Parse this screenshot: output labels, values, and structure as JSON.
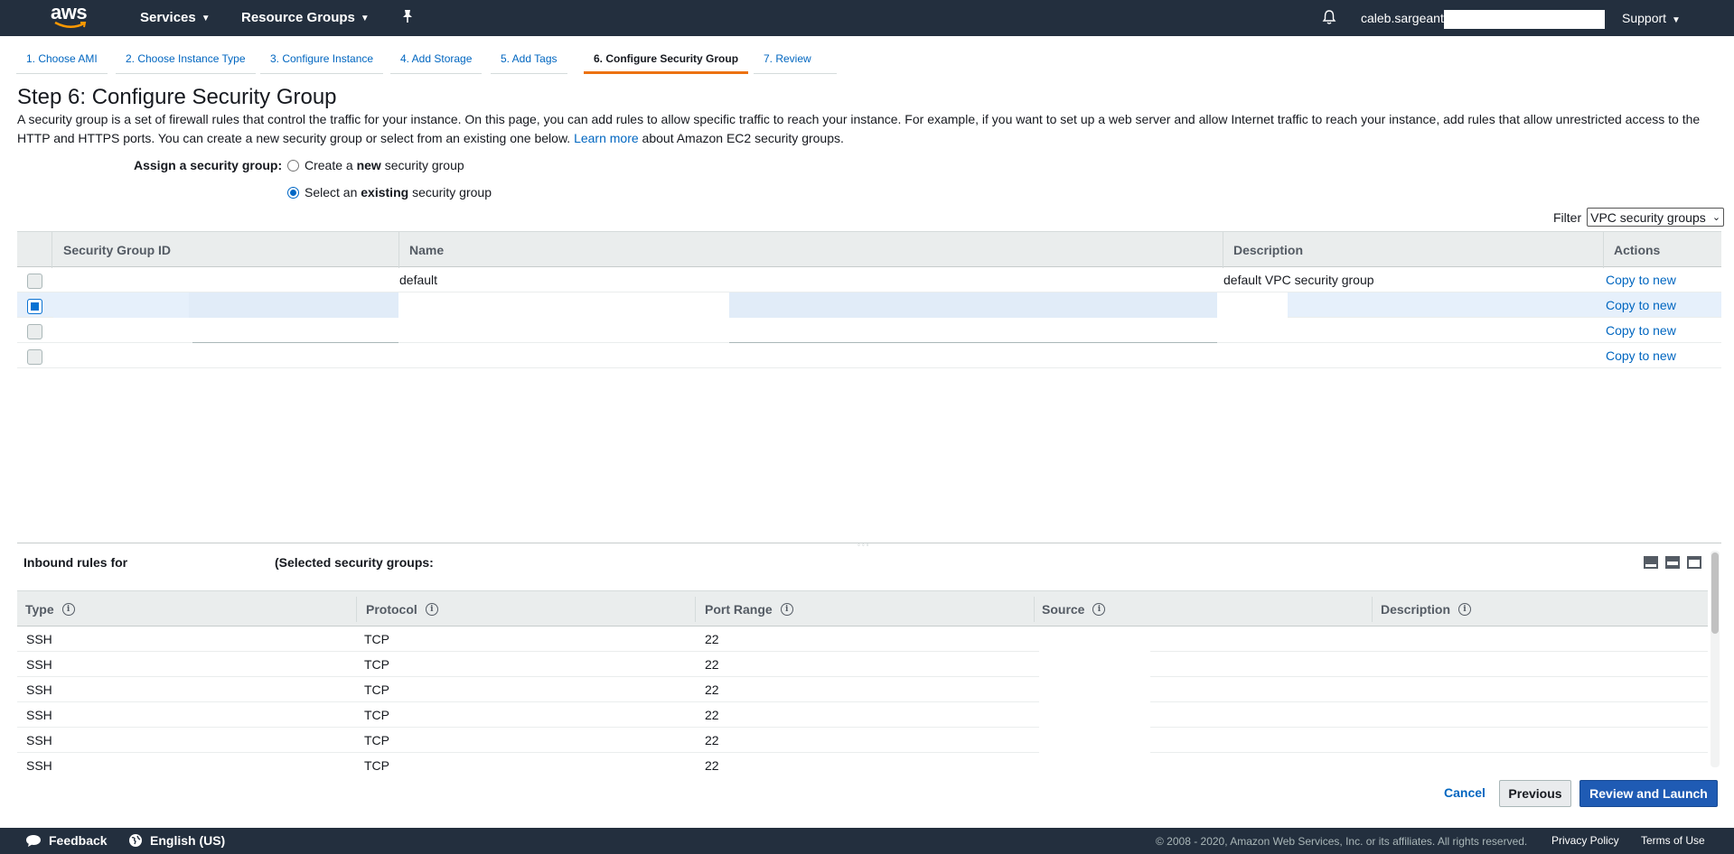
{
  "topnav": {
    "logo_text": "aws",
    "services": "Services",
    "resource_groups": "Resource Groups",
    "username": "caleb.sargeant",
    "support": "Support"
  },
  "wizard_tabs": [
    {
      "label": "1. Choose AMI"
    },
    {
      "label": "2. Choose Instance Type"
    },
    {
      "label": "3. Configure Instance"
    },
    {
      "label": "4. Add Storage"
    },
    {
      "label": "5. Add Tags"
    },
    {
      "label": "6. Configure Security Group",
      "active": true
    },
    {
      "label": "7. Review"
    }
  ],
  "page": {
    "title": "Step 6: Configure Security Group",
    "intro_text": "A security group is a set of firewall rules that control the traffic for your instance. On this page, you can add rules to allow specific traffic to reach your instance. For example, if you want to set up a web server and allow Internet traffic to reach your instance, add rules that allow unrestricted access to the HTTP and HTTPS ports. You can create a new security group or select from an existing one below.",
    "learn_more": "Learn more",
    "intro_suffix": "about Amazon EC2 security groups."
  },
  "assign": {
    "label": "Assign a security group:",
    "option_new_pre": "Create a",
    "option_new_bold": "new",
    "option_new_post": "security group",
    "option_existing_pre": "Select an",
    "option_existing_bold": "existing",
    "option_existing_post": "security group",
    "selected": "existing"
  },
  "filter": {
    "label": "Filter",
    "value": "VPC security groups"
  },
  "sg_table": {
    "headers": {
      "id": "Security Group ID",
      "name": "Name",
      "description": "Description",
      "actions": "Actions"
    },
    "rows": [
      {
        "name": "default",
        "description": "default VPC security group",
        "action": "Copy to new",
        "checked": false
      },
      {
        "name": "",
        "description": "",
        "action": "Copy to new",
        "checked": true
      },
      {
        "name": "",
        "description": "",
        "action": "Copy to new",
        "checked": false
      },
      {
        "name": "",
        "description": "",
        "action": "Copy to new",
        "checked": false
      }
    ]
  },
  "inbound": {
    "title": "Inbound rules for",
    "selected_label": "(Selected security groups:",
    "headers": {
      "type": "Type",
      "protocol": "Protocol",
      "port_range": "Port Range",
      "source": "Source",
      "description": "Description"
    },
    "rows": [
      {
        "type": "SSH",
        "protocol": "TCP",
        "port": "22"
      },
      {
        "type": "SSH",
        "protocol": "TCP",
        "port": "22"
      },
      {
        "type": "SSH",
        "protocol": "TCP",
        "port": "22"
      },
      {
        "type": "SSH",
        "protocol": "TCP",
        "port": "22"
      },
      {
        "type": "SSH",
        "protocol": "TCP",
        "port": "22"
      },
      {
        "type": "SSH",
        "protocol": "TCP",
        "port": "22"
      }
    ]
  },
  "actions": {
    "cancel": "Cancel",
    "previous": "Previous",
    "review_launch": "Review and Launch"
  },
  "footer": {
    "feedback": "Feedback",
    "language": "English (US)",
    "copyright": "© 2008 - 2020, Amazon Web Services, Inc. or its affiliates. All rights reserved.",
    "privacy": "Privacy Policy",
    "terms": "Terms of Use"
  }
}
